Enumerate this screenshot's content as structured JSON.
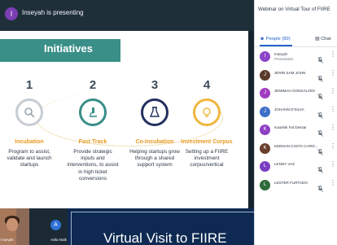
{
  "presenting_bar": {
    "avatar_letter": "I",
    "text": "Inseyah is presenting"
  },
  "slide": {
    "title": "Initiatives",
    "steps": [
      {
        "number": "1",
        "title": "Incubation",
        "desc": "Program to assist, validate and launch startups",
        "color": "#c7ccd1",
        "icon": "magnifier-icon"
      },
      {
        "number": "2",
        "title": "Fast Track",
        "desc": "Provide strategic inputs and interventions, to assist in high ticket conversions",
        "color": "#3a8f88",
        "icon": "microscope-icon"
      },
      {
        "number": "3",
        "title": "Co-Incubation",
        "desc": "Helping startups grow through a shared support system",
        "color": "#23305f",
        "icon": "flask-icon"
      },
      {
        "number": "4",
        "title": "Investment Corpus",
        "desc": "Setting up a FIIRE investment corpus/vertical",
        "color": "#f0b63d",
        "icon": "lightbulb-icon"
      }
    ]
  },
  "panel": {
    "header": "Webinar on Virtual Tour of FIIRE",
    "tabs": {
      "people": "People (89)",
      "chat": "Chat"
    },
    "participants": [
      {
        "initial": "I",
        "name": "Inseyah",
        "role": "Presentation",
        "color": "#8b45c9"
      },
      {
        "initial": "J",
        "name": "JERIN SAM JOHN",
        "role": "",
        "color": "#5a3a2a"
      },
      {
        "initial": "J",
        "name": "JEMIMAH GONSALVES",
        "role": "",
        "color": "#a03cc0"
      },
      {
        "initial": "J",
        "name": "JOHANN D'SILVA",
        "role": "",
        "color": "#3e6fc7"
      },
      {
        "initial": "K",
        "name": "Kaushik Fal Dessai",
        "role": "",
        "color": "#8e3fc4"
      },
      {
        "initial": "K",
        "name": "KEENAN COSTA CARD...",
        "role": "",
        "color": "#6b3e2c"
      },
      {
        "initial": "L",
        "name": "LENNY VAZ",
        "role": "",
        "color": "#7a3ec2"
      },
      {
        "initial": "L",
        "name": "LESTER FURTADO",
        "role": "",
        "color": "#2e6b3a"
      }
    ]
  },
  "bottom": {
    "video_name": "Inseyah",
    "a_letter": "A",
    "a_name": "Avila Naik",
    "title_card": "Virtual Visit to FIIRE"
  }
}
